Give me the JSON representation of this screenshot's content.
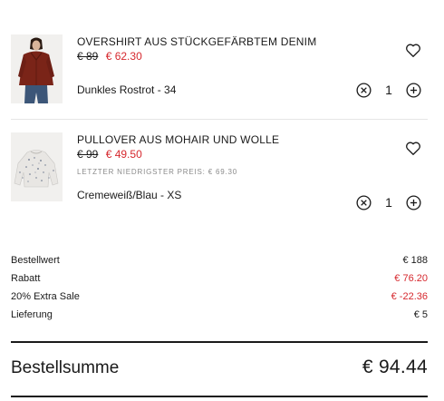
{
  "cart": {
    "items": [
      {
        "name": "OVERSHIRT AUS STÜCKGEFÄRBTEM DENIM",
        "old_price": "€ 89",
        "new_price": "€ 62.30",
        "variant": "Dunkles Rostrot - 34",
        "quantity": "1",
        "icons": {
          "wishlist": "heart-outline-icon",
          "decrease": "circle-x-icon",
          "increase": "circle-plus-icon"
        }
      },
      {
        "name": "PULLOVER AUS MOHAIR UND WOLLE",
        "old_price": "€ 99",
        "new_price": "€ 49.50",
        "lowest_price_note": "LETZTER NIEDRIGSTER PREIS: € 69.30",
        "variant": "Cremeweiß/Blau - XS",
        "quantity": "1",
        "icons": {
          "wishlist": "heart-outline-icon",
          "decrease": "circle-x-icon",
          "increase": "circle-plus-icon"
        }
      }
    ]
  },
  "summary": {
    "rows": [
      {
        "label": "Bestellwert",
        "value": "€ 188"
      },
      {
        "label": "Rabatt",
        "value": "€ 76.20"
      },
      {
        "label": "20% Extra Sale",
        "value": "€ -22.36"
      },
      {
        "label": "Lieferung",
        "value": "€ 5"
      }
    ],
    "total_label": "Bestellsumme",
    "total_value": "€ 94.44"
  },
  "colors": {
    "sale_red": "#d6282e",
    "text": "#1a1a1a",
    "muted": "#8a8a8a"
  }
}
